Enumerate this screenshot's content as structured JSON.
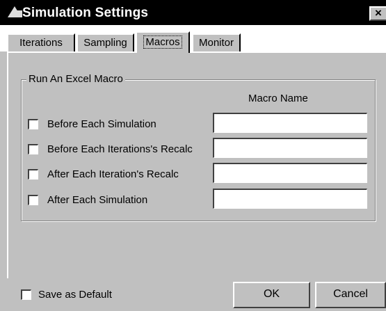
{
  "window": {
    "title": "Simulation Settings",
    "close_glyph": "×",
    "app_icon": "mountain-icon"
  },
  "tabs": [
    {
      "label": "Iterations",
      "active": false
    },
    {
      "label": "Sampling",
      "active": false
    },
    {
      "label": "Macros",
      "active": true
    },
    {
      "label": "Monitor",
      "active": false
    }
  ],
  "macros": {
    "group_title": "Run An Excel Macro",
    "column_header": "Macro Name",
    "rows": [
      {
        "label": "Before Each Simulation",
        "checked": false,
        "macro_name": ""
      },
      {
        "label": "Before Each Iterations's Recalc",
        "checked": false,
        "macro_name": ""
      },
      {
        "label": "After Each Iteration's Recalc",
        "checked": false,
        "macro_name": ""
      },
      {
        "label": "After Each Simulation",
        "checked": false,
        "macro_name": ""
      }
    ]
  },
  "footer": {
    "save_default_label": "Save as Default",
    "save_default_checked": false,
    "ok_label": "OK",
    "cancel_label": "Cancel"
  }
}
